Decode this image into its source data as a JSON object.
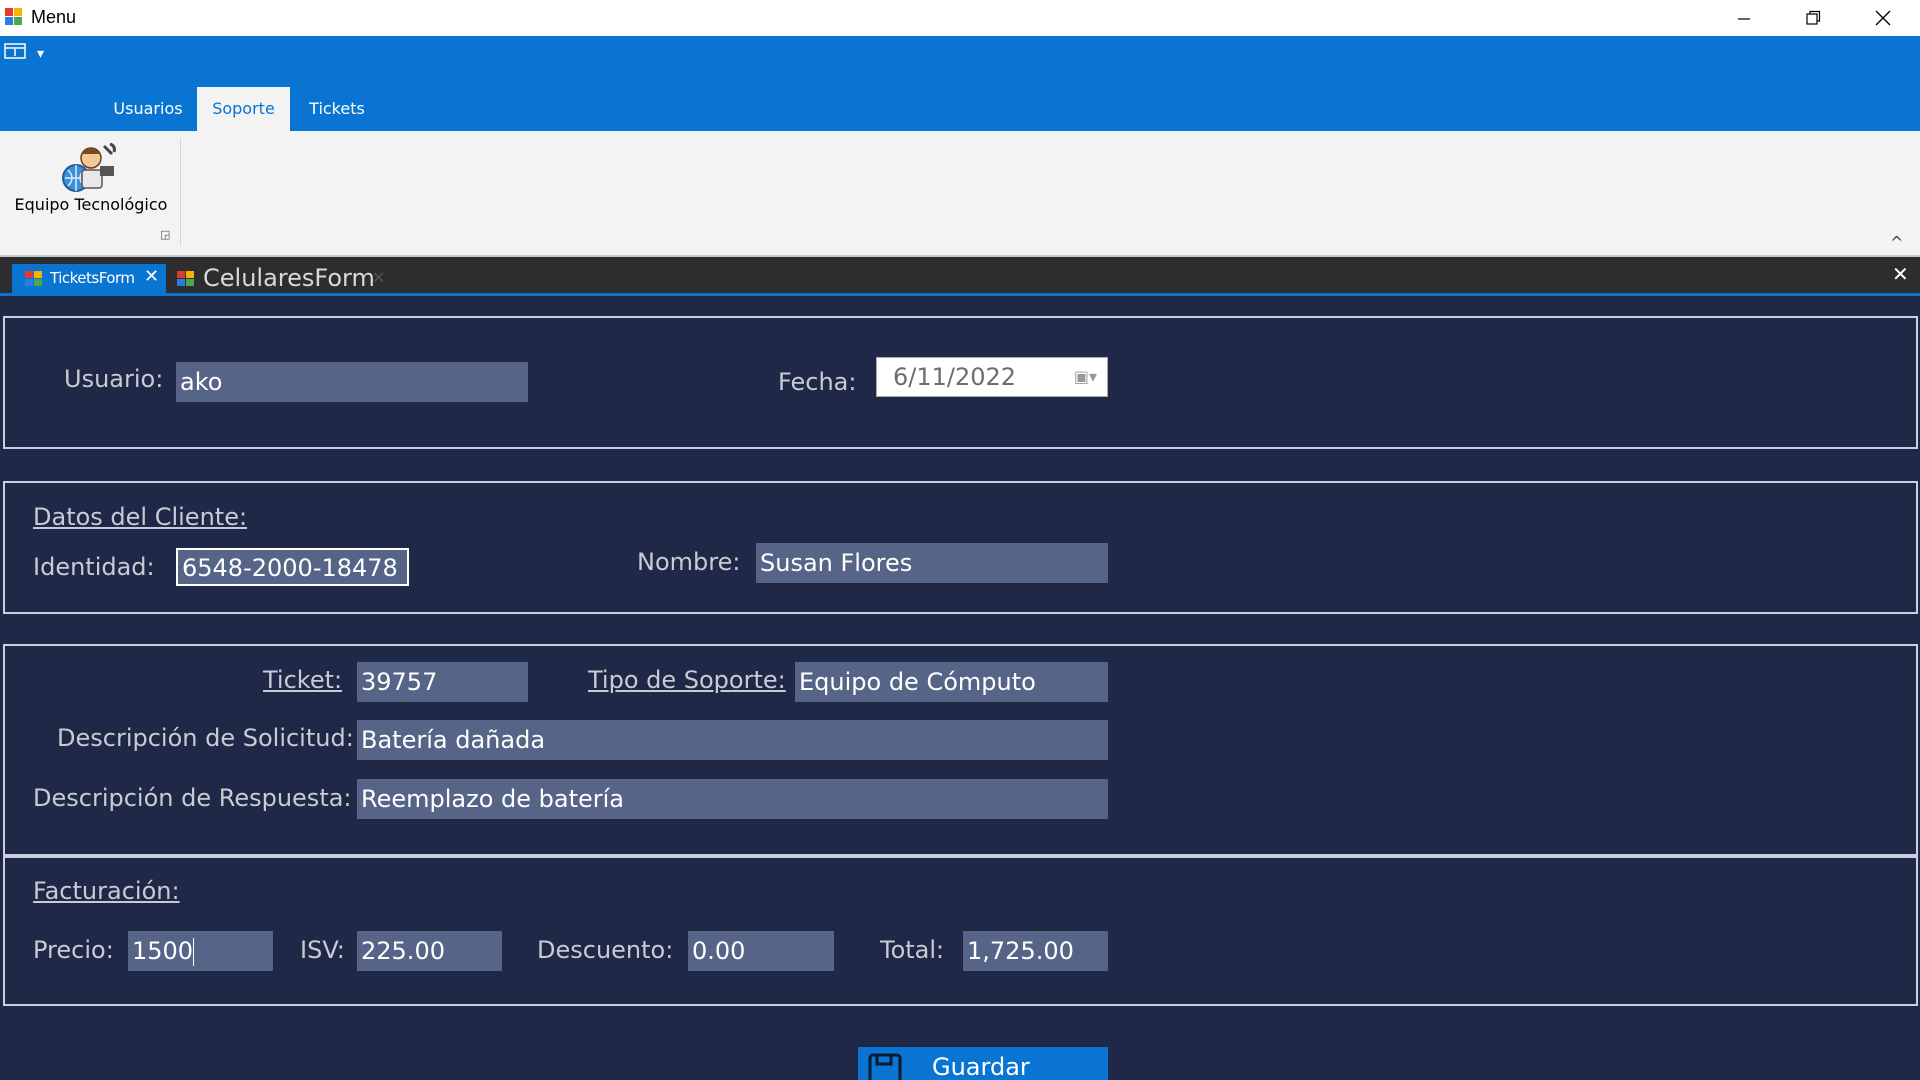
{
  "window": {
    "title": "Menu",
    "controls": [
      "minimize-icon",
      "restore-icon",
      "close-icon"
    ]
  },
  "ribbon": {
    "tabs": [
      {
        "label": "Usuarios",
        "active": false
      },
      {
        "label": "Soporte",
        "active": true
      },
      {
        "label": "Tickets",
        "active": false
      }
    ],
    "buttons": [
      {
        "label": "Equipo Tecnológico",
        "icon": "technician-icon"
      }
    ]
  },
  "document_tabs": [
    {
      "label": "TicketsForm",
      "active": true
    },
    {
      "label": "CelularesForm",
      "active": false
    }
  ],
  "form": {
    "usuario_label": "Usuario:",
    "usuario_value": "ako",
    "fecha_label": "Fecha:",
    "fecha_value": "6/11/2022",
    "cliente_heading": "Datos del Cliente:",
    "identidad_label": "Identidad:",
    "identidad_value": "6548-2000-18478",
    "nombre_label": "Nombre:",
    "nombre_value": "Susan Flores",
    "ticket_label": "Ticket:",
    "ticket_value": "39757",
    "tipo_label": "Tipo de Soporte:",
    "tipo_value": "Equipo de Cómputo",
    "solicitud_label": "Descripción de Solicitud:",
    "solicitud_value": "Batería dañada",
    "respuesta_label": "Descripción de Respuesta:",
    "respuesta_value": "Reemplazo de batería",
    "facturacion_heading": "Facturación:",
    "precio_label": "Precio:",
    "precio_value": "1500",
    "isv_label": "ISV:",
    "isv_value": "225.00",
    "descuento_label": "Descuento:",
    "descuento_value": "0.00",
    "total_label": "Total:",
    "total_value": "1,725.00",
    "save_label": "Guardar"
  },
  "colors": {
    "ribbon_blue": "#0a74d2",
    "form_background": "#1f2847",
    "field_background": "#566488"
  }
}
